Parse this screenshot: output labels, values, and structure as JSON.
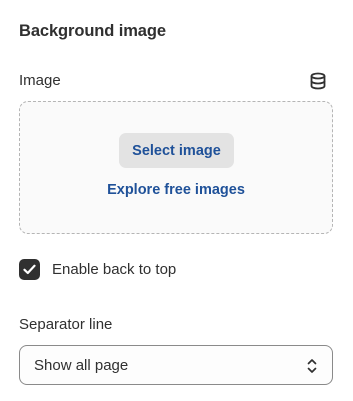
{
  "section": {
    "heading": "Background image"
  },
  "image_field": {
    "label": "Image",
    "icon": "database-icon",
    "select_button": "Select image",
    "explore_link": "Explore free images"
  },
  "back_to_top": {
    "label": "Enable back to top",
    "checked": true
  },
  "separator": {
    "label": "Separator line",
    "selected": "Show all page"
  },
  "colors": {
    "text": "#303030",
    "link": "#1f5199",
    "button_bg": "#e3e3e3",
    "checkbox_bg": "#303030",
    "dropzone_border": "#b5b5b5"
  }
}
